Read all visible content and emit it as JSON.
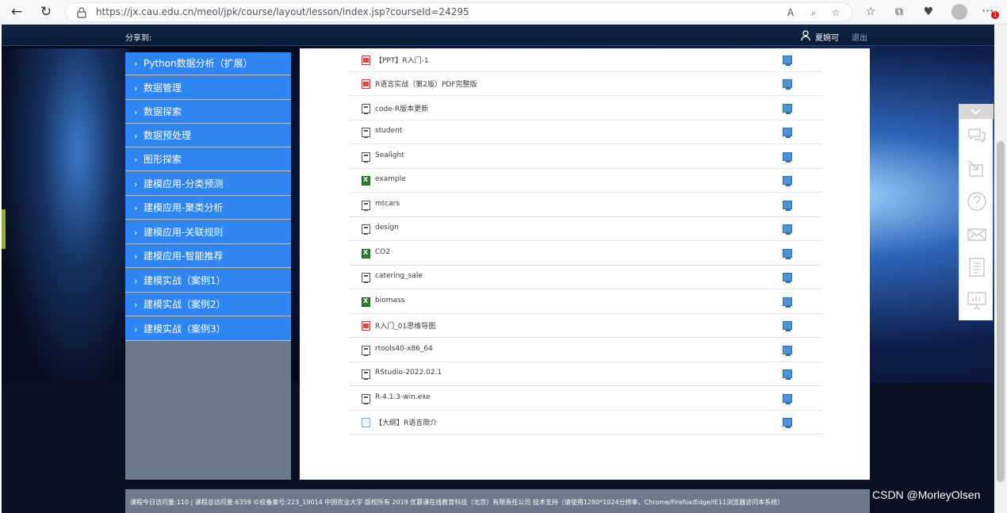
{
  "browser": {
    "url": "https://jx.cau.edu.cn/meol/jpk/course/layout/lesson/index.jsp?courseId=24295",
    "notification_count": "1"
  },
  "topbar": {
    "share_label": "分享到:",
    "username": "夏婉可",
    "logout_label": "退出"
  },
  "leftnav": {
    "items": [
      {
        "label": "Python数据分析（扩展）"
      },
      {
        "label": "数据管理"
      },
      {
        "label": "数据探索"
      },
      {
        "label": "数据预处理"
      },
      {
        "label": "图形探索"
      },
      {
        "label": "建模应用-分类预测"
      },
      {
        "label": "建模应用-聚类分析"
      },
      {
        "label": "建模应用-关联规则"
      },
      {
        "label": "建模应用-智能推荐"
      },
      {
        "label": "建模实战（案例1）"
      },
      {
        "label": "建模实战（案例2）"
      },
      {
        "label": "建模实战（案例3）"
      }
    ]
  },
  "files": [
    {
      "name": "【PPT】R入门-1",
      "type": "pdf"
    },
    {
      "name": "R语言实战（第2版）PDF完整版",
      "type": "pdf"
    },
    {
      "name": "code-R版本更新",
      "type": "doc"
    },
    {
      "name": "student",
      "type": "doc"
    },
    {
      "name": "Sealight",
      "type": "doc"
    },
    {
      "name": "example",
      "type": "xls"
    },
    {
      "name": "mtcars",
      "type": "doc"
    },
    {
      "name": "design",
      "type": "doc"
    },
    {
      "name": "CO2",
      "type": "xls"
    },
    {
      "name": "catering_sale",
      "type": "doc"
    },
    {
      "name": "biomass",
      "type": "xls"
    },
    {
      "name": "R入门_01思维导图",
      "type": "pdf"
    },
    {
      "name": "rtools40-x86_64",
      "type": "doc"
    },
    {
      "name": "RStudio-2022.02.1",
      "type": "doc"
    },
    {
      "name": "R-4.1.3-win.exe",
      "type": "doc"
    },
    {
      "name": "【大纲】R语言简介",
      "type": "txt"
    }
  ],
  "sidetool": {
    "icons": [
      "chat-icon",
      "resize-icon",
      "help-icon",
      "mail-icon",
      "notes-icon",
      "presentation-icon"
    ]
  },
  "footer": {
    "text": "课程今日访问量:110 | 课程总访问量:6359 ©校备案号:223_19014 中国农业大学 版权所有 2019 优慕课在线教育科技（北京）有限责任公司 技术支持（请使用1280*1024分辨率，Chrome/Firefox/Edge/IE11浏览器访问本系统）"
  },
  "watermark": "CSDN @MorleyOlsen"
}
